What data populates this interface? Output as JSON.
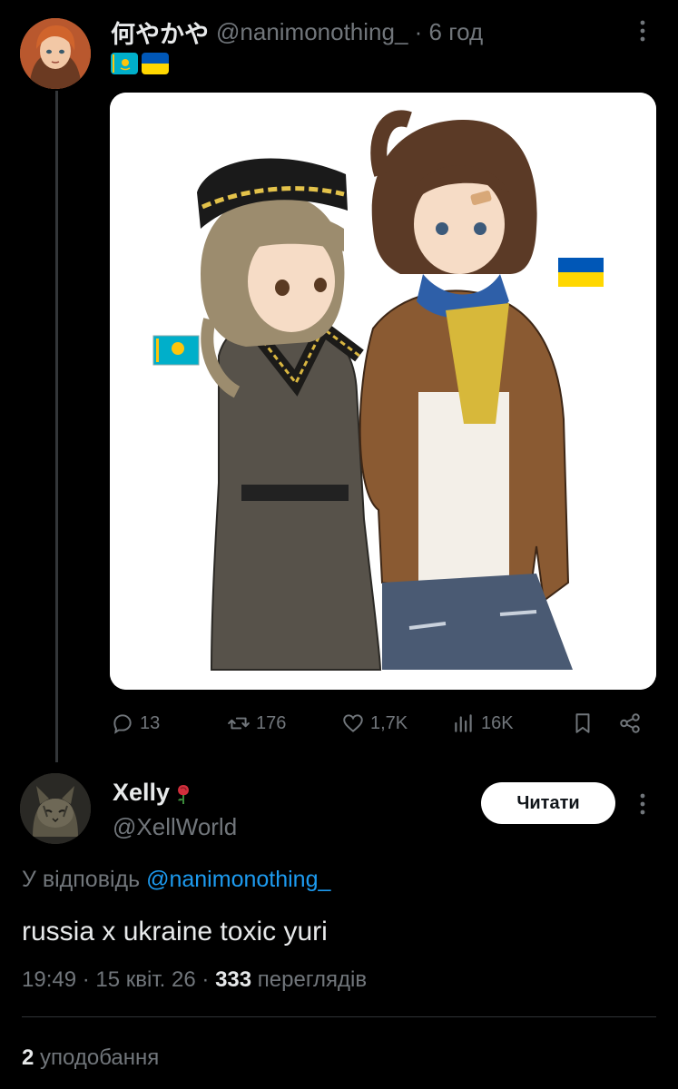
{
  "original_tweet": {
    "display_name": "何やかや",
    "handle": "@nanimonothing_",
    "time": "· 6 год",
    "flag_emojis": [
      "kazakhstan-flag",
      "ukraine-flag"
    ],
    "colors": {
      "kz_blue": "#00AFCA",
      "kz_gold": "#FEC50C",
      "ua_blue": "#0057B7",
      "ua_yellow": "#FFD700"
    },
    "actions": {
      "replies": "13",
      "reposts": "176",
      "likes": "1,7K",
      "views": "16K"
    }
  },
  "reply_tweet": {
    "display_name": "Xelly",
    "name_emoji": "🌹",
    "handle": "@XellWorld",
    "follow_label": "Читати",
    "reply_prefix": "У відповідь",
    "reply_to_handle": "@nanimonothing_",
    "text": "russia x ukraine toxic yuri",
    "time": "19:49",
    "date": "15 квіт. 26",
    "views_count": "333",
    "views_label": "переглядів",
    "likes_count": "2",
    "likes_label": "уподобання"
  },
  "theme": {
    "background": "#000000",
    "text": "#e7e9ea",
    "muted": "#71767b",
    "link": "#1d9bf0"
  }
}
